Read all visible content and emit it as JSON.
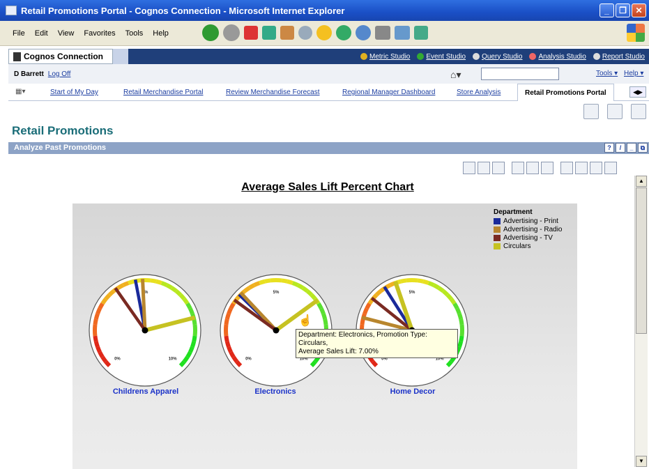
{
  "window": {
    "title": "Retail Promotions Portal - Cognos Connection - Microsoft Internet Explorer"
  },
  "menu": [
    "File",
    "Edit",
    "View",
    "Favorites",
    "Tools",
    "Help"
  ],
  "cognos": {
    "app_title": "Cognos Connection",
    "studios": [
      "Metric Studio",
      "Event Studio",
      "Query Studio",
      "Analysis Studio",
      "Report Studio"
    ],
    "user": "D Barrett",
    "logoff": "Log Off",
    "tools_menu": "Tools",
    "help_menu": "Help"
  },
  "tabs": [
    "Start of My Day",
    "Retail Merchandise Portal",
    "Review Merchandise Forecast",
    "Regional Manager Dashboard",
    "Store Analysis",
    "Retail Promotions Portal"
  ],
  "active_tab": "Retail Promotions Portal",
  "page": {
    "title": "Retail Promotions",
    "portlet_title": "Analyze Past Promotions"
  },
  "portlet_controls": [
    "?",
    "/",
    "_",
    "⧉"
  ],
  "chart_data": {
    "type": "gauge",
    "title": "Average Sales Lift Percent Chart",
    "legend_title": "Department",
    "series": [
      {
        "name": "Advertising - Print",
        "color": "#1a2a9a"
      },
      {
        "name": "Advertising - Radio",
        "color": "#b8862e"
      },
      {
        "name": "Advertising - TV",
        "color": "#7a2a22"
      },
      {
        "name": "Circulars",
        "color": "#c6c222"
      }
    ],
    "gauges": [
      {
        "category": "Childrens Apparel",
        "values": [
          4.6,
          4.9,
          3.7,
          7.8
        ]
      },
      {
        "category": "Electronics",
        "values": [
          3.3,
          3.4,
          3.0,
          7.0
        ]
      },
      {
        "category": "Home Decor",
        "values": [
          3.8,
          2.2,
          3.1,
          4.3
        ]
      }
    ],
    "scale_labels": {
      "min": "0%",
      "mid": "5%",
      "max": "10%"
    },
    "scale_range": [
      0,
      10
    ],
    "legend_placement": "top-right"
  },
  "tooltip": {
    "line1": "Department: Electronics, Promotion Type: Circulars,",
    "line2": "Average Sales Lift: 7.00%"
  }
}
